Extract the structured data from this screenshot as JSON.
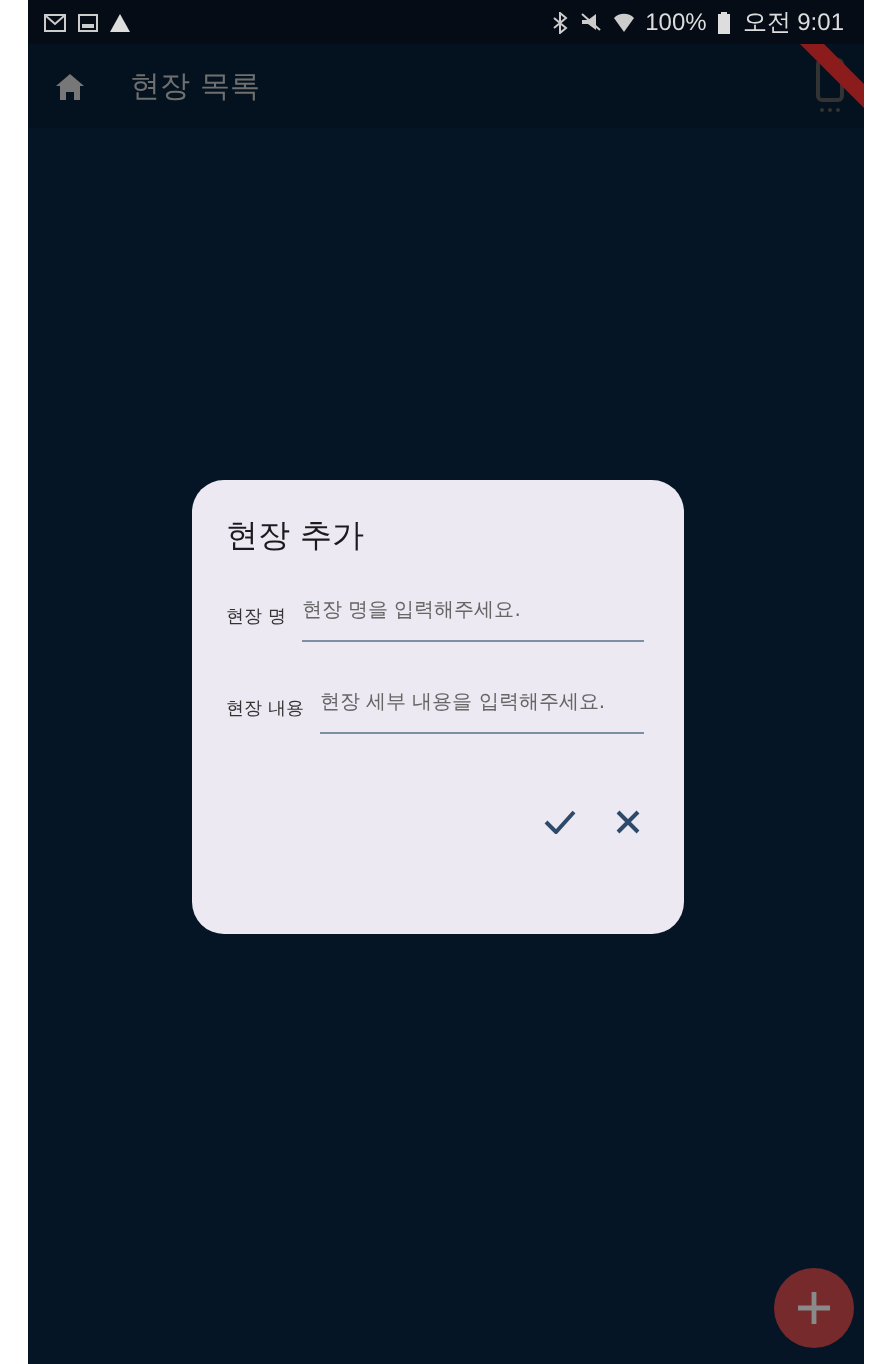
{
  "status_bar": {
    "battery": "100%",
    "time": "오전 9:01"
  },
  "app_bar": {
    "title": "현장 목록"
  },
  "dialog": {
    "title": "현장 추가",
    "fields": [
      {
        "label": "현장 명",
        "placeholder": "현장 명을 입력해주세요."
      },
      {
        "label": "현장 내용",
        "placeholder": "현장 세부 내용을 입력해주세요."
      }
    ],
    "actions": [
      {
        "kind": "confirm"
      },
      {
        "kind": "cancel"
      }
    ]
  }
}
